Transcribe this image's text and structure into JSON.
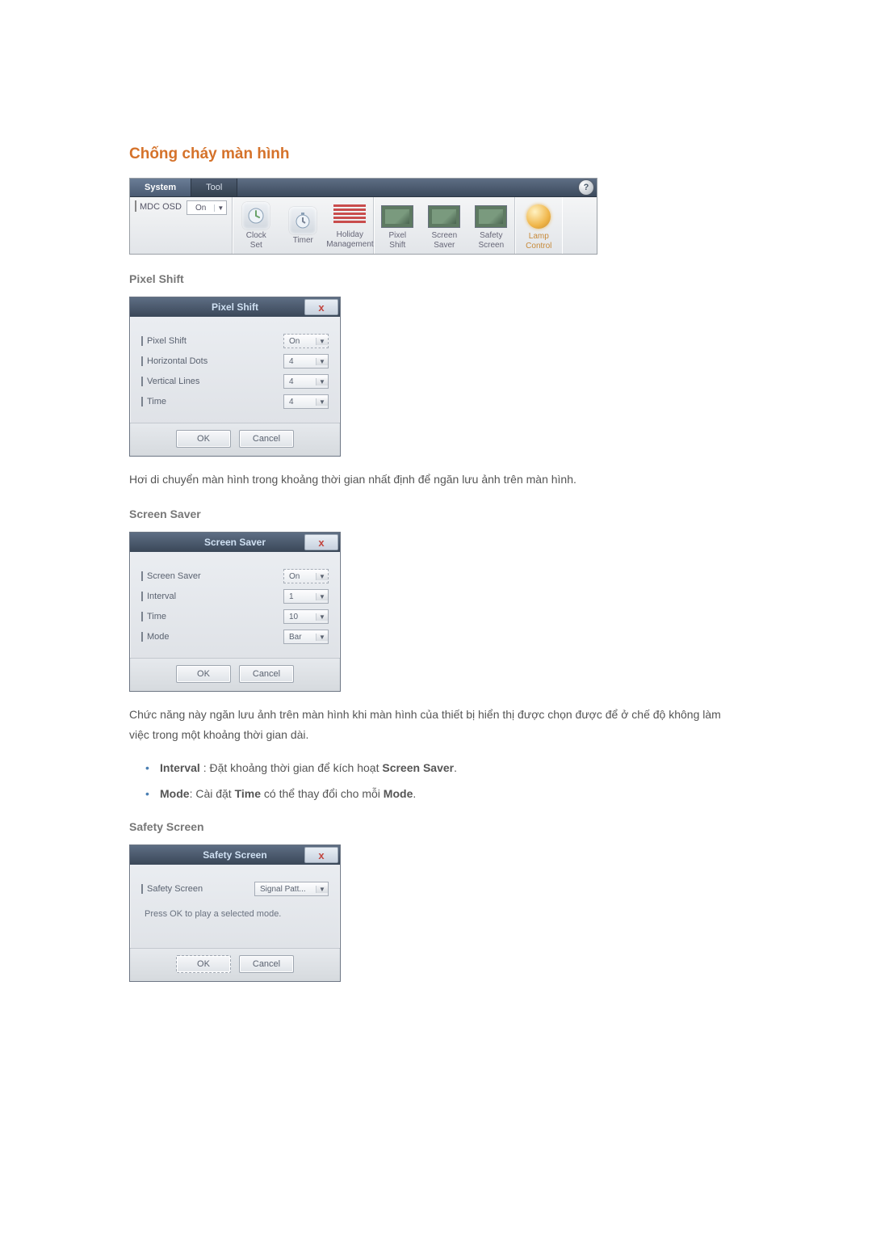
{
  "title": "Chống cháy màn hình",
  "toolbar": {
    "tabs": {
      "system": "System",
      "tool": "Tool"
    },
    "help": "?",
    "osd": {
      "label": "MDC OSD",
      "value": "On"
    },
    "buttons": {
      "clock_set": "Clock\nSet",
      "timer": "Timer",
      "holiday": "Holiday\nManagement",
      "pixel_shift": "Pixel\nShift",
      "screen_saver": "Screen\nSaver",
      "safety_screen": "Safety\nScreen",
      "lamp_control": "Lamp\nControl"
    }
  },
  "sections": {
    "pixel_shift": {
      "heading": "Pixel Shift",
      "dialog_title": "Pixel Shift",
      "fields": {
        "pixel_shift": {
          "label": "Pixel Shift",
          "value": "On"
        },
        "horizontal_dots": {
          "label": "Horizontal Dots",
          "value": "4"
        },
        "vertical_lines": {
          "label": "Vertical Lines",
          "value": "4"
        },
        "time": {
          "label": "Time",
          "value": "4"
        }
      },
      "ok": "OK",
      "cancel": "Cancel",
      "paragraph": "Hơi di chuyển màn hình trong khoảng thời gian nhất định để ngăn lưu ảnh trên màn hình."
    },
    "screen_saver": {
      "heading": "Screen Saver",
      "dialog_title": "Screen Saver",
      "fields": {
        "screen_saver": {
          "label": "Screen Saver",
          "value": "On"
        },
        "interval": {
          "label": "Interval",
          "value": "1"
        },
        "time": {
          "label": "Time",
          "value": "10"
        },
        "mode": {
          "label": "Mode",
          "value": "Bar"
        }
      },
      "ok": "OK",
      "cancel": "Cancel",
      "paragraph": "Chức năng này ngăn lưu ảnh trên màn hình khi màn hình của thiết bị hiển thị được chọn được để ở chế độ không làm việc trong một khoảng thời gian dài.",
      "notes": {
        "interval_b": "Interval",
        "interval_t": " : Đặt khoảng thời gian để kích hoạt ",
        "interval_b2": "Screen Saver",
        "interval_end": ".",
        "mode_b": "Mode",
        "mode_t1": ": Cài đặt ",
        "mode_b2": "Time",
        "mode_t2": " có thể thay đổi cho mỗi ",
        "mode_b3": "Mode",
        "mode_end": "."
      }
    },
    "safety_screen": {
      "heading": "Safety Screen",
      "dialog_title": "Safety Screen",
      "fields": {
        "safety_screen": {
          "label": "Safety Screen",
          "value": "Signal Patt..."
        }
      },
      "info": "Press OK to play a selected mode.",
      "ok": "OK",
      "cancel": "Cancel"
    }
  },
  "close_x": "x"
}
